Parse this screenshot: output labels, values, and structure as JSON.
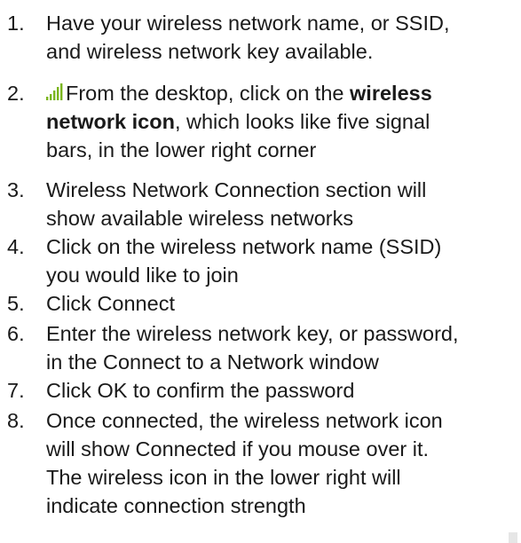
{
  "steps": [
    {
      "number": "1.",
      "lines": [
        "Have your wireless network name, or SSID,",
        "and wireless network key available."
      ]
    },
    {
      "number": "2.",
      "icon": "wireless-signal-bars-icon",
      "line1_pre": "From the desktop, click on the ",
      "line1_bold": "wireless",
      "line2_bold": "network icon",
      "line2_post": ", which looks like five signal",
      "line3": "bars, in the lower right corner"
    },
    {
      "number": "3.",
      "lines": [
        "Wireless Network Connection section will",
        "show available wireless networks"
      ]
    },
    {
      "number": "4.",
      "lines": [
        "Click on the wireless network name (SSID)",
        "you would like to join"
      ]
    },
    {
      "number": "5.",
      "lines": [
        "Click Connect"
      ]
    },
    {
      "number": "6.",
      "lines": [
        "Enter the wireless network key, or password,",
        "in the Connect to a Network window"
      ]
    },
    {
      "number": "7.",
      "lines": [
        "Click OK to confirm the password"
      ]
    },
    {
      "number": "8.",
      "lines": [
        "Once connected, the wireless network icon",
        "will show Connected if you mouse over it.",
        "The wireless icon in the lower right will",
        "indicate connection strength"
      ]
    }
  ],
  "colors": {
    "text": "#1a1a1a",
    "signal_icon": "#7ab51d"
  }
}
